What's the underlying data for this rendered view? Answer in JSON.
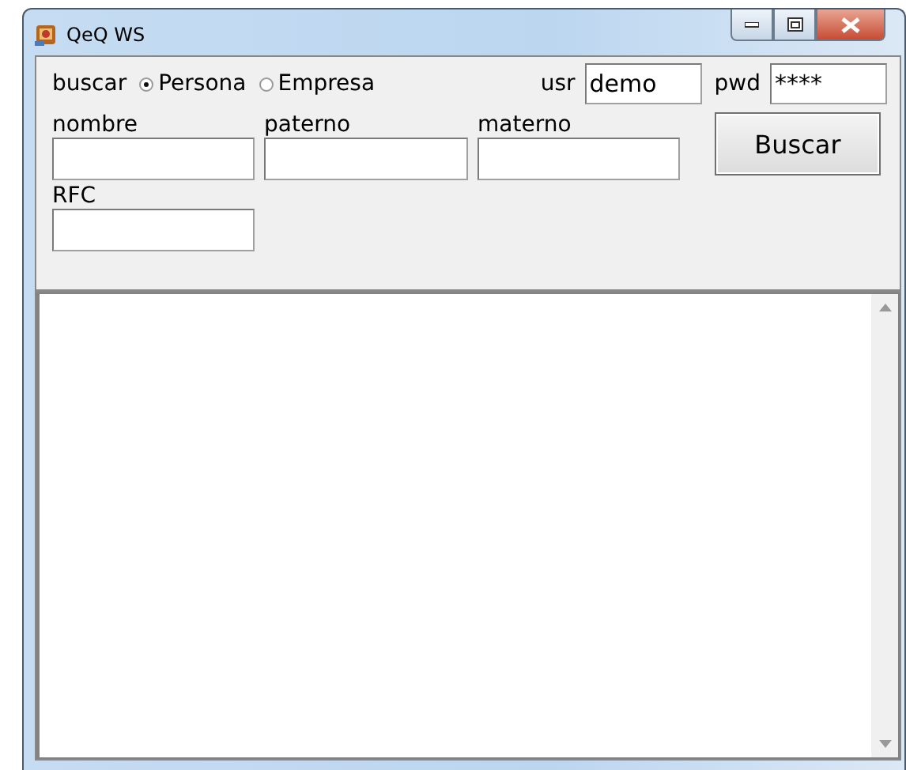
{
  "window": {
    "title": "QeQ WS"
  },
  "search_type": {
    "label": "buscar",
    "options": [
      {
        "label": "Persona",
        "selected": true
      },
      {
        "label": "Empresa",
        "selected": false
      }
    ]
  },
  "credentials": [
    {
      "label": "usr",
      "value": "demo"
    },
    {
      "label": "pwd",
      "value": "****"
    }
  ],
  "name_fields": [
    {
      "label": "nombre"
    },
    {
      "label": "paterno"
    },
    {
      "label": "materno"
    }
  ],
  "rfc": {
    "label": "RFC"
  },
  "buttons": [
    {
      "label": "Buscar"
    }
  ]
}
